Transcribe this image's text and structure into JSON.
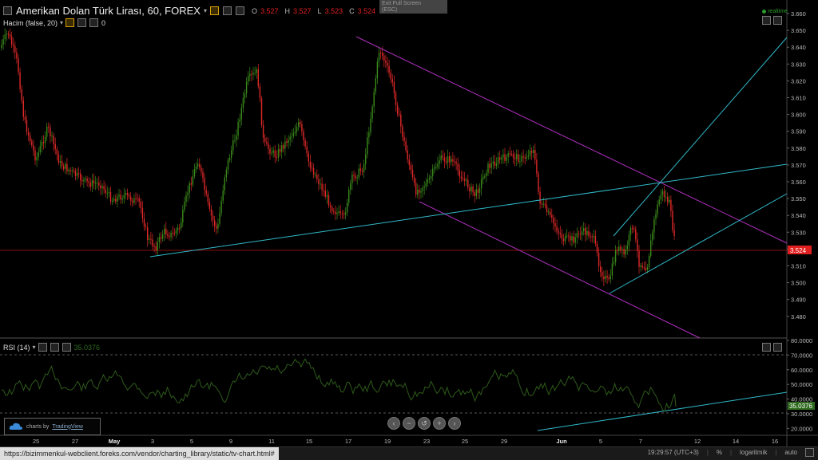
{
  "legend": {
    "title": "Amerikan Dolan Türk Lirası, 60, FOREX",
    "o_label": "O",
    "o_value": "3.527",
    "h_label": "H",
    "h_value": "3.527",
    "l_label": "L",
    "l_value": "3.523",
    "c_label": "C",
    "c_value": "3.524"
  },
  "volume_legend": {
    "label": "Hacim (false, 20)",
    "value": "0"
  },
  "rsi_legend": {
    "label": "RSI (14)",
    "value": "35.0376"
  },
  "exit_fullscreen": {
    "line1": "Exit Full Screen",
    "line2": "(ESC)"
  },
  "realtime_label": "realtime",
  "badge": {
    "prefix": "charts by",
    "brand": "TradingView"
  },
  "nav_buttons": [
    "‹",
    "−",
    "↺",
    "+",
    "›"
  ],
  "status": {
    "url": "https://bizimmenkul-webclient.foreks.com/vendor/charting_library/static/tv-chart.html#",
    "time": "19:29:57 (UTC+3)",
    "percent": "%",
    "log": "logaritmik",
    "auto": "auto"
  },
  "price_axis": {
    "ticks": [
      "3.660",
      "3.650",
      "3.640",
      "3.630",
      "3.620",
      "3.610",
      "3.600",
      "3.590",
      "3.580",
      "3.570",
      "3.560",
      "3.550",
      "3.540",
      "3.530",
      "3.520",
      "3.510",
      "3.500",
      "3.490",
      "3.480"
    ],
    "current": "3.524"
  },
  "rsi_axis": {
    "ticks": [
      "80.0000",
      "70.0000",
      "60.0000",
      "50.0000",
      "40.0000",
      "30.0000",
      "20.0000"
    ],
    "current": "35.0376"
  },
  "time_axis": {
    "ticks": [
      "25",
      "27",
      "May",
      "3",
      "5",
      "9",
      "11",
      "15",
      "17",
      "19",
      "23",
      "25",
      "29",
      "Jun",
      "5",
      "7",
      "12",
      "14",
      "16"
    ]
  },
  "colors": {
    "up": "#3a8a1a",
    "down": "#e02828",
    "channel": "#b030c0",
    "trend": "#30b8c8",
    "rsi_line": "#2e5a1a",
    "price_line": "#e02020"
  }
}
